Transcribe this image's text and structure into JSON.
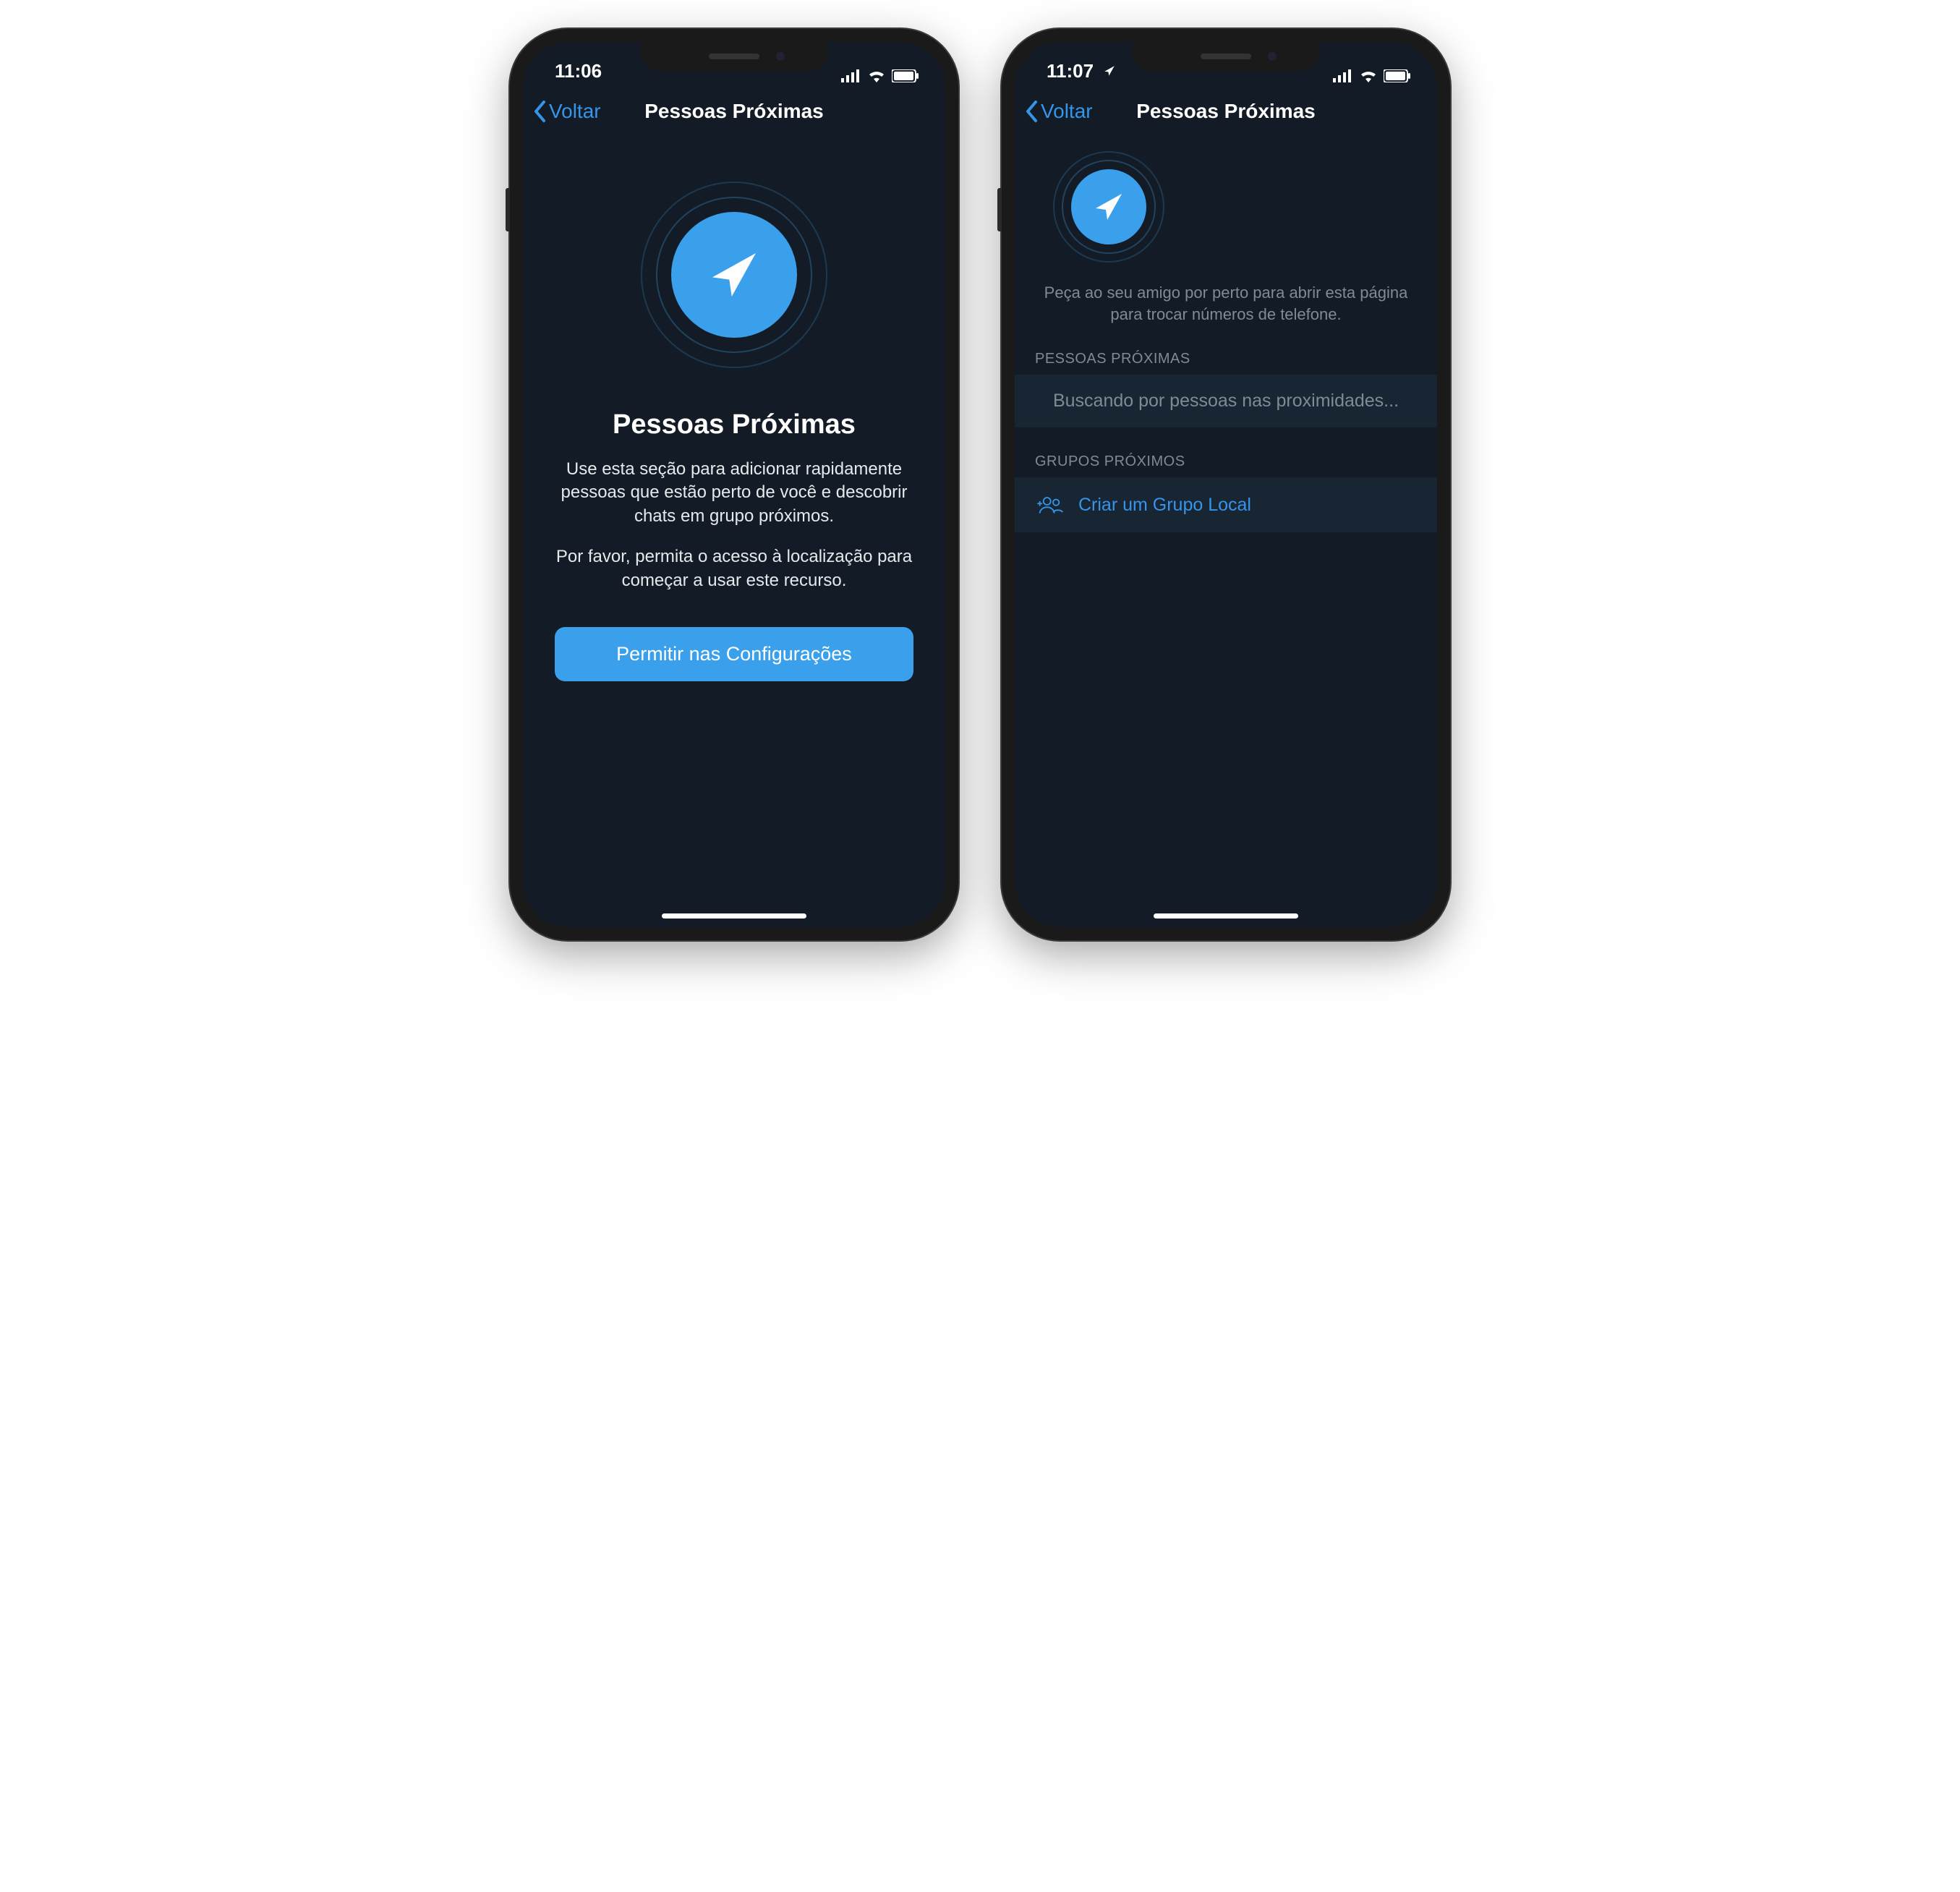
{
  "phones": {
    "left": {
      "status": {
        "time": "11:06"
      },
      "nav": {
        "back": "Voltar",
        "title": "Pessoas Próximas"
      },
      "hero": {
        "title": "Pessoas Próximas",
        "body1": "Use esta seção para adicionar rapidamente pessoas que estão perto de você e descobrir chats em grupo próximos.",
        "body2": "Por favor, permita o acesso à localização para começar a usar este recurso.",
        "button": "Permitir nas Configurações"
      }
    },
    "right": {
      "status": {
        "time": "11:07"
      },
      "nav": {
        "back": "Voltar",
        "title": "Pessoas Próximas"
      },
      "intro": "Peça ao seu amigo por perto para abrir esta página para trocar números de telefone.",
      "section_people": {
        "header": "PESSOAS PRÓXIMAS",
        "searching": "Buscando por pessoas nas proximidades..."
      },
      "section_groups": {
        "header": "GRUPOS PRÓXIMOS",
        "create": "Criar um Grupo Local"
      }
    }
  }
}
